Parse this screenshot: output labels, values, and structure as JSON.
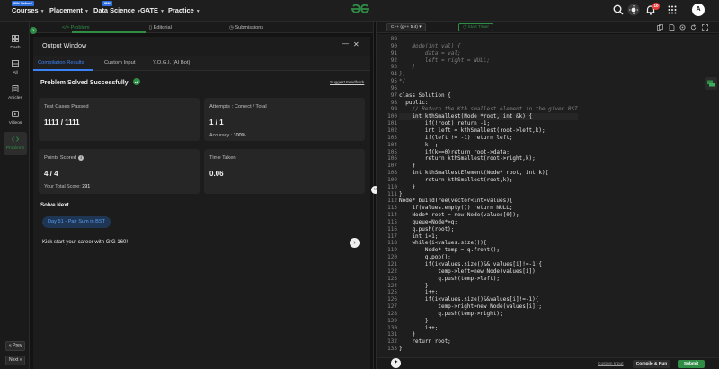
{
  "topnav": {
    "courses": "Courses",
    "courses_badge": "90% Refund",
    "placement": "Placement",
    "data_science": "Data Science",
    "data_science_badge": "IBM",
    "gate": "GATE",
    "practice": "Practice",
    "notification_count": "10",
    "avatar_letter": "A"
  },
  "sidebar": {
    "items": [
      {
        "label": "Dash",
        "icon": "dashboard-icon"
      },
      {
        "label": "All",
        "icon": "grid-icon"
      },
      {
        "label": "Articles",
        "icon": "article-icon"
      },
      {
        "label": "Videos",
        "icon": "video-icon"
      },
      {
        "label": "Problems",
        "icon": "code-icon"
      }
    ],
    "prev_label": "« Prev",
    "next_label": "Next »"
  },
  "tabs": {
    "problem": "Problem",
    "editorial": "Editorial",
    "submissions": "Submissions"
  },
  "output": {
    "title": "Output Window",
    "subtabs": [
      "Compilation Results",
      "Custom Input",
      "Y.O.G.I. (AI Bot)"
    ],
    "status": "Problem Solved Successfully",
    "suggest_feedback": "Suggest Feedback",
    "test_cases_label": "Test Cases Passed",
    "test_cases_value": "1111 / 1111",
    "attempts_label": "Attempts : Correct / Total",
    "attempts_value": "1 / 1",
    "accuracy_label": "Accuracy :",
    "accuracy_value": "100%",
    "points_label": "Points Scored",
    "points_value": "4 / 4",
    "total_score_label": "Your Total Score:",
    "total_score_value": "291",
    "time_label": "Time Taken",
    "time_value": "0.06",
    "solve_next": "Solve Next",
    "next_problem": "Day 51 - Pair Sum in BST",
    "kick_start": "Kick start your career with GfG 160!"
  },
  "editor": {
    "language": "C++ (g++ 5.4)",
    "start_timer": "Start Timer",
    "custom_input": "Custom Input",
    "compile_run": "Compile & Run",
    "submit": "Submit",
    "accent": "#2f8d46",
    "first_line": 89,
    "lines": [
      "",
      "    Node(int val) {",
      "        data = val;",
      "        left = right = NULL;",
      "    }",
      "};",
      "*/",
      "",
      "class Solution {",
      "  public:",
      "    // Return the Kth smallest element in the given BST",
      "    int kthSmallest(Node *root, int &k) {",
      "        if(!root) return -1;",
      "        int left = kthSmallest(root->left,k);",
      "        if(left != -1) return left;",
      "        k--;",
      "        if(k==0)return root->data;",
      "        return kthSmallest(root->right,k);",
      "    }",
      "    int kthSmallestElement(Node* root, int k){",
      "        return kthSmallest(root,k);",
      "    }",
      "};",
      "Node* buildTree(vector<int>values){",
      "    if(values.empty()) return NULL;",
      "    Node* root = new Node(values[0]);",
      "    queue<Node*>q;",
      "    q.push(root);",
      "    int i=1;",
      "    while(i<values.size()){",
      "        Node* temp = q.front();",
      "        q.pop();",
      "        if(i<values.size()&& values[i]!=-1){",
      "            temp->left=new Node(values[i]);",
      "            q.push(temp->left);",
      "        }",
      "        i++;",
      "        if(i<values.size()&&values[i]!=-1){",
      "            temp->right=new Node(values[i]);",
      "            q.push(temp->right);",
      "        }",
      "        i++;",
      "    }",
      "    return root;",
      "}"
    ]
  }
}
